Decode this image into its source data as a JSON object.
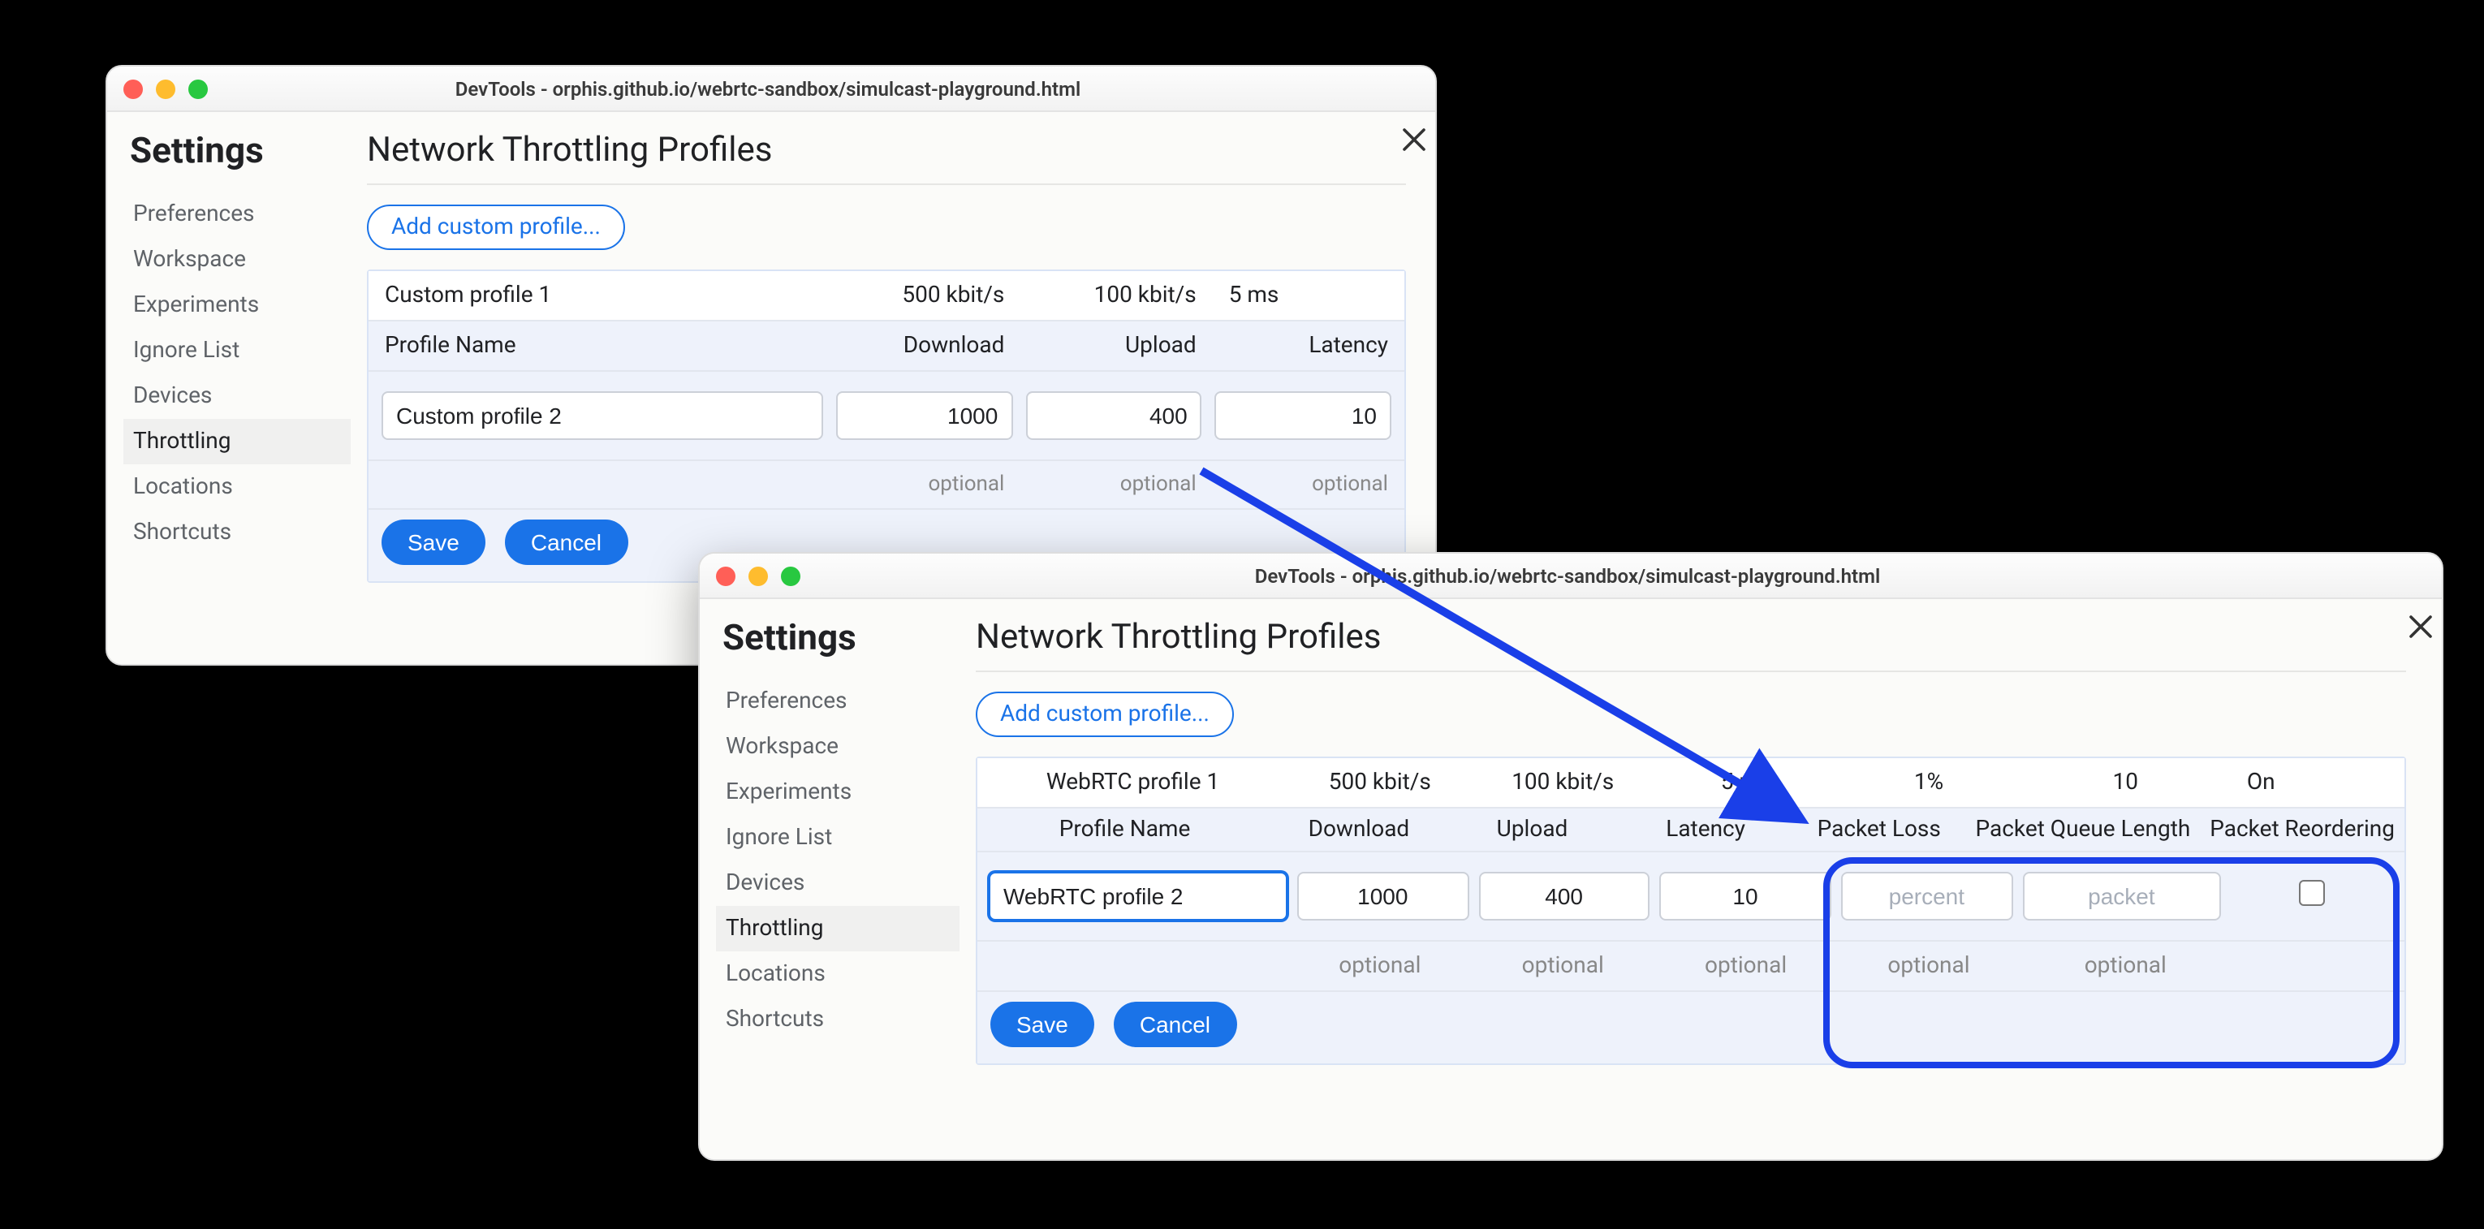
{
  "window_title": "DevTools - orphis.github.io/webrtc-sandbox/simulcast-playground.html",
  "settings_heading": "Settings",
  "sidebar_items": [
    {
      "label": "Preferences"
    },
    {
      "label": "Workspace"
    },
    {
      "label": "Experiments"
    },
    {
      "label": "Ignore List"
    },
    {
      "label": "Devices"
    },
    {
      "label": "Throttling"
    },
    {
      "label": "Locations"
    },
    {
      "label": "Shortcuts"
    }
  ],
  "main_title": "Network Throttling Profiles",
  "add_custom_label": "Add custom profile...",
  "back": {
    "existing_row": {
      "name": "Custom profile 1",
      "download": "500 kbit/s",
      "upload": "100 kbit/s",
      "latency": "5 ms"
    },
    "headers": {
      "name": "Profile Name",
      "download": "Download",
      "upload": "Upload",
      "latency": "Latency"
    },
    "edit": {
      "name": "Custom profile 2",
      "download": "1000",
      "upload": "400",
      "latency": "10"
    },
    "hints": {
      "download": "optional",
      "upload": "optional",
      "latency": "optional"
    }
  },
  "front": {
    "existing_row": {
      "name": "WebRTC profile 1",
      "download": "500 kbit/s",
      "upload": "100 kbit/s",
      "latency": "5 ms",
      "packet_loss": "1%",
      "packet_queue": "10",
      "reordering": "On"
    },
    "headers": {
      "name": "Profile Name",
      "download": "Download",
      "upload": "Upload",
      "latency": "Latency",
      "packet_loss": "Packet Loss",
      "packet_queue": "Packet Queue Length",
      "reordering": "Packet Reordering"
    },
    "edit": {
      "name": "WebRTC profile 2",
      "download": "1000",
      "upload": "400",
      "latency": "10",
      "packet_loss_placeholder": "percent",
      "packet_queue_placeholder": "packet"
    },
    "hints": {
      "download": "optional",
      "upload": "optional",
      "latency": "optional",
      "packet_loss": "optional",
      "packet_queue": "optional"
    }
  },
  "buttons": {
    "save": "Save",
    "cancel": "Cancel"
  }
}
